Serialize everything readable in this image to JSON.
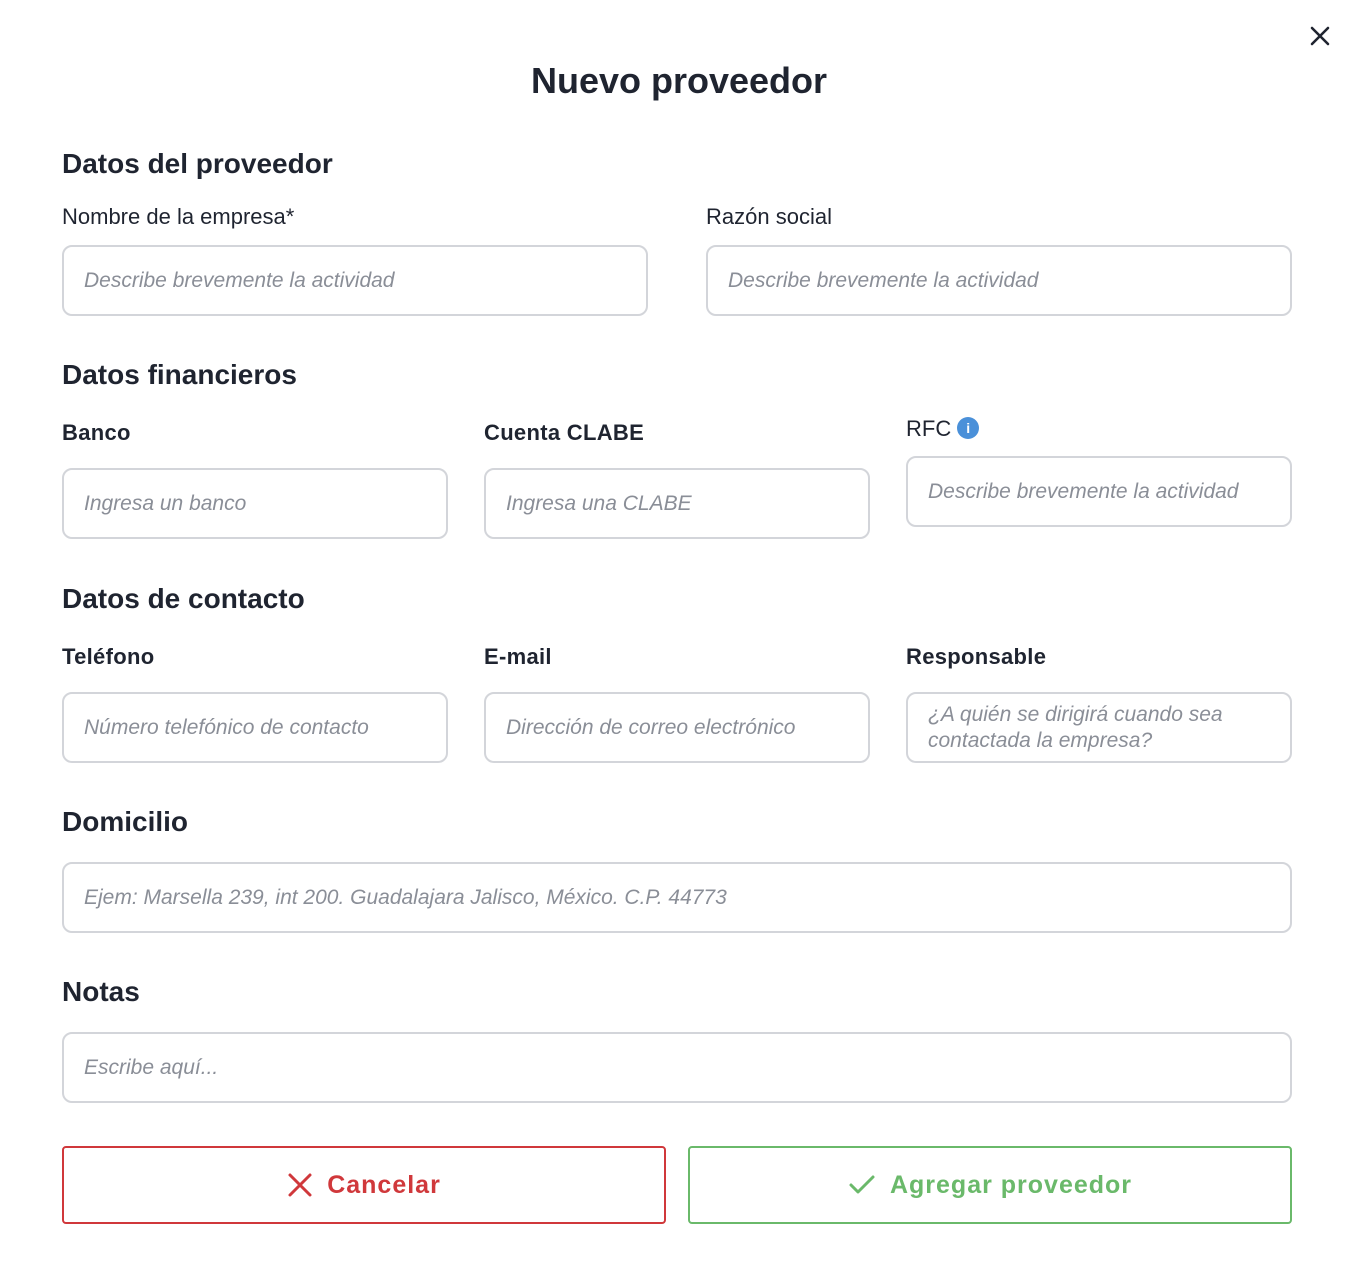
{
  "modal": {
    "title": "Nuevo proveedor",
    "close_icon": "close-icon"
  },
  "sections": {
    "provider": "Datos del proveedor",
    "financial": "Datos financieros",
    "contact": "Datos de contacto",
    "address": "Domicilio",
    "notes": "Notas"
  },
  "fields": {
    "company_name": {
      "label": "Nombre de la empresa*",
      "placeholder": "Describe brevemente la actividad",
      "value": ""
    },
    "business_name": {
      "label": "Razón social",
      "placeholder": "Describe brevemente la actividad",
      "value": ""
    },
    "bank": {
      "label": "Banco",
      "placeholder": "Ingresa un banco",
      "value": ""
    },
    "clabe": {
      "label": "Cuenta CLABE",
      "placeholder": "Ingresa una CLABE",
      "value": ""
    },
    "rfc": {
      "label": "RFC",
      "placeholder": "Describe brevemente la actividad",
      "value": "",
      "info_icon": "i"
    },
    "phone": {
      "label": "Teléfono",
      "placeholder": "Número telefónico de contacto",
      "value": ""
    },
    "email": {
      "label": "E-mail",
      "placeholder": "Dirección de correo electrónico",
      "value": ""
    },
    "responsible": {
      "label": "Responsable",
      "placeholder": "¿A quién se dirigirá cuando sea contactada la empresa?",
      "value": ""
    },
    "address": {
      "placeholder": "Ejem: Marsella 239, int 200. Guadalajara Jalisco, México. C.P. 44773",
      "value": ""
    },
    "notes": {
      "placeholder": "Escribe aquí...",
      "value": ""
    }
  },
  "buttons": {
    "cancel": "Cancelar",
    "add": "Agregar proveedor"
  },
  "colors": {
    "cancel": "#d0383b",
    "add": "#6ab96a",
    "info": "#4a90d9",
    "border": "#d3d5da"
  }
}
